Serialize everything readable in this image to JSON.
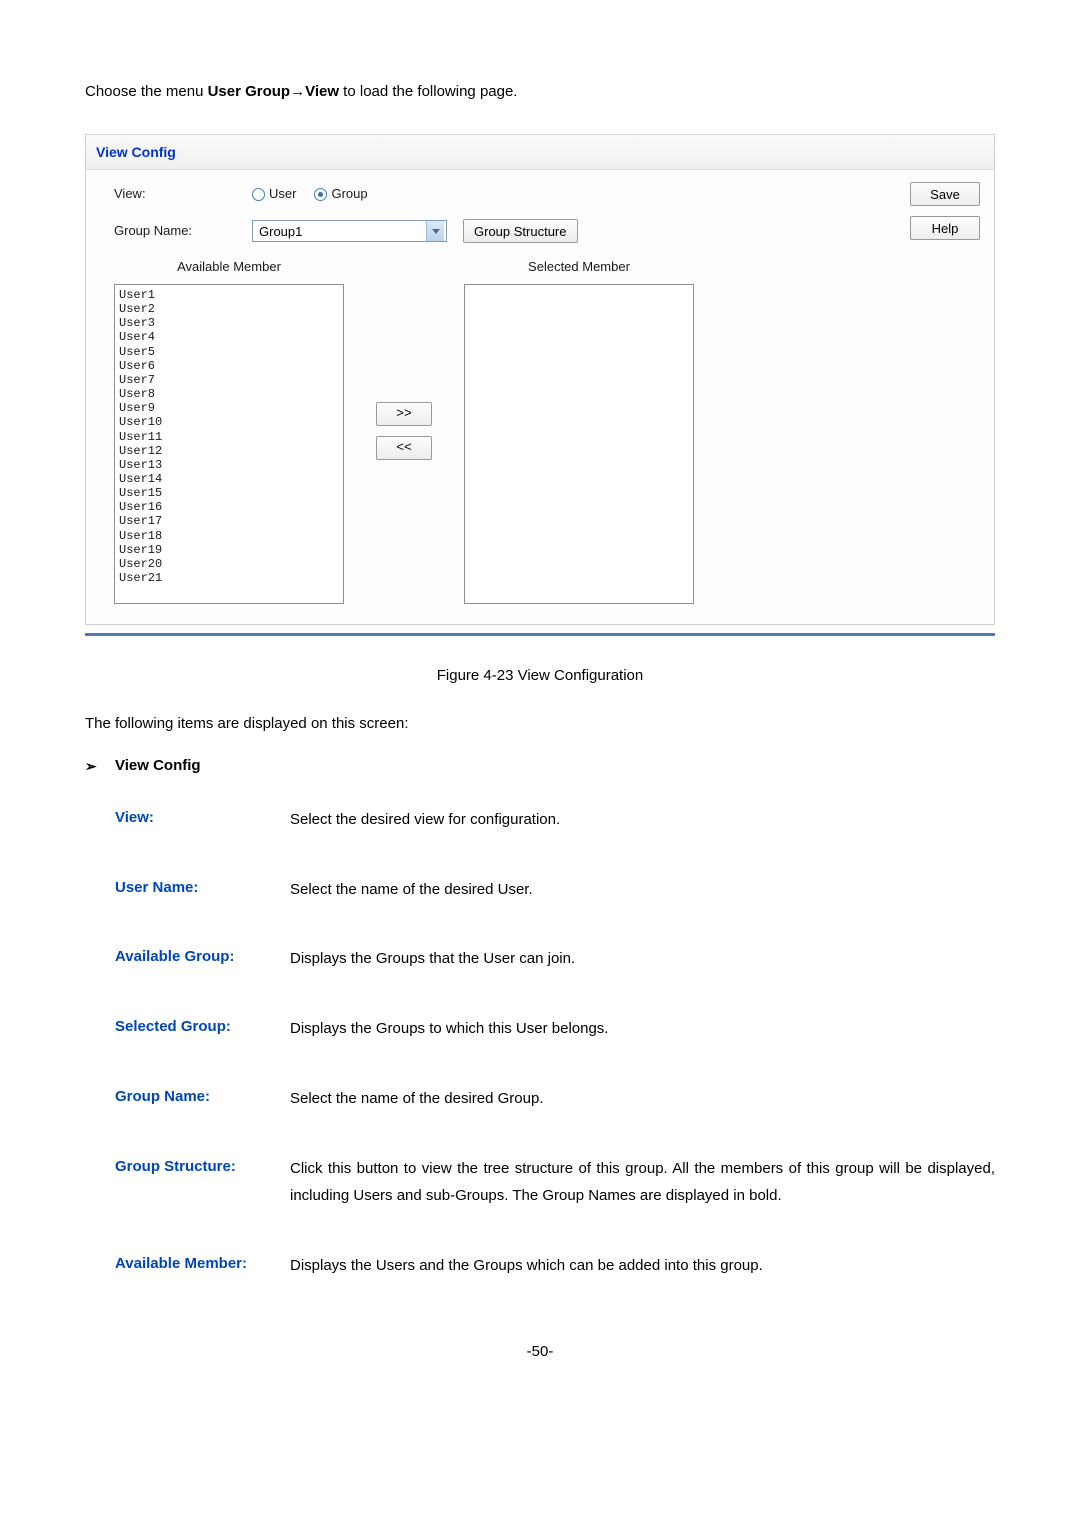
{
  "intro": {
    "prefix": "Choose the menu ",
    "bold": "User Group→View",
    "suffix": " to load the following page."
  },
  "panel": {
    "title": "View Config",
    "viewLabel": "View:",
    "radio": {
      "user": "User",
      "group": "Group"
    },
    "groupNameLabel": "Group Name:",
    "groupNameValue": "Group1",
    "groupStructureBtn": "Group Structure",
    "saveBtn": "Save",
    "helpBtn": "Help",
    "availableTitle": "Available Member",
    "selectedTitle": "Selected Member",
    "moveRight": ">>",
    "moveLeft": "<<",
    "availableMembers": [
      "User1",
      "User2",
      "User3",
      "User4",
      "User5",
      "User6",
      "User7",
      "User8",
      "User9",
      "User10",
      "User11",
      "User12",
      "User13",
      "User14",
      "User15",
      "User16",
      "User17",
      "User18",
      "User19",
      "User20",
      "User21"
    ]
  },
  "figureCaption": "Figure 4-23 View Configuration",
  "subIntro": "The following items are displayed on this screen:",
  "sectionHeading": "View Config",
  "fields": [
    {
      "label": "View:",
      "desc": "Select the desired view for configuration."
    },
    {
      "label": "User Name:",
      "desc": "Select the name of the desired User."
    },
    {
      "label": "Available Group:",
      "desc": "Displays the Groups that the User can join."
    },
    {
      "label": "Selected Group:",
      "desc": "Displays the Groups to which this User belongs."
    },
    {
      "label": "Group Name:",
      "desc": "Select the name of the desired Group."
    },
    {
      "label": "Group Structure:",
      "desc": "Click this button to view the tree structure of this group. All the members of this group will be displayed, including Users and sub-Groups. The Group Names are displayed in bold."
    },
    {
      "label": "Available Member:",
      "desc": "Displays the Users and the Groups which can be added into this group."
    }
  ],
  "pageNumber": "-50-"
}
